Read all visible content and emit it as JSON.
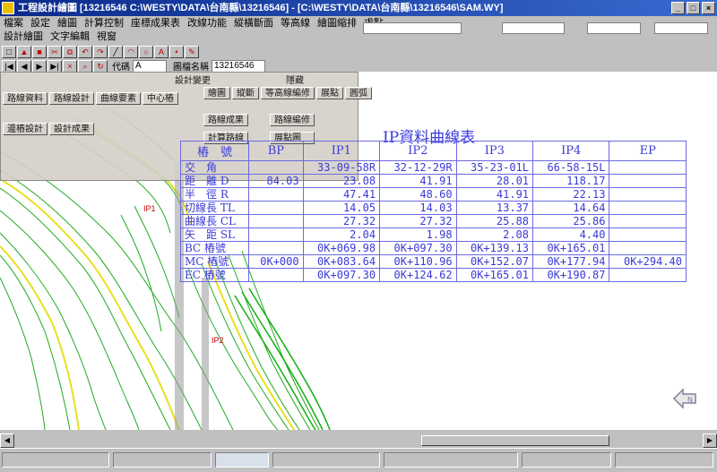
{
  "window": {
    "title": "工程設計繪圖 [13216546 C:\\WESTY\\DATA\\台南縣\\13216546] - [C:\\WESTY\\DATA\\台南縣\\13216546\\SAM.WY]",
    "controls": [
      "_",
      "□",
      "×"
    ]
  },
  "menu": {
    "row1": [
      "檔案",
      "設定",
      "繪圖",
      "計算控制",
      "座標成果表",
      "改線功能",
      "縱橫斷面",
      "等高線",
      "繪圖縮排",
      "求點"
    ],
    "row2": [
      "設計繪圖",
      "文字編輯",
      "視窗"
    ]
  },
  "toolbar": {
    "code_label": "代碼",
    "code_value": "A",
    "layer_label": "圖檔名稱",
    "layer_value": "13216546",
    "sublabel": "設計變更",
    "right_label": "隱藏"
  },
  "panel": {
    "tabs": [
      "繪圖",
      "縱斷",
      "等高線編修",
      "展點",
      "圓弧"
    ],
    "side_items": [
      "路線資料",
      "路線設計",
      "曲線要素",
      "中心樁",
      "邊樁設計",
      "設計成果"
    ],
    "buttons": [
      "路線成果",
      "計算路線",
      "路線編修",
      "展點圖"
    ]
  },
  "curve_table": {
    "title": "IP資料曲線表",
    "columns": [
      "樁　號",
      "BP",
      "IP1",
      "IP2",
      "IP3",
      "IP4",
      "EP"
    ],
    "rows": [
      {
        "label": "交　角",
        "values": [
          "",
          "",
          "33-09-58R",
          "32-12-29R",
          "35-23-01L",
          "66-58-15L",
          ""
        ]
      },
      {
        "label": "距　離 D",
        "values": [
          "",
          "84.03",
          "23.08",
          "41.91",
          "28.01",
          "118.17",
          ""
        ]
      },
      {
        "label": "半　徑 R",
        "values": [
          "",
          "",
          "47.41",
          "48.60",
          "41.91",
          "22.13",
          ""
        ]
      },
      {
        "label": "切線長 TL",
        "values": [
          "",
          "",
          "14.05",
          "14.03",
          "13.37",
          "14.64",
          ""
        ]
      },
      {
        "label": "曲線長 CL",
        "values": [
          "",
          "",
          "27.32",
          "27.32",
          "25.88",
          "25.86",
          ""
        ]
      },
      {
        "label": "矢　距 SL",
        "values": [
          "",
          "",
          "2.04",
          "1.98",
          "2.08",
          "4.40",
          ""
        ]
      },
      {
        "label": "BC 樁號",
        "values": [
          "",
          "",
          "0K+069.98",
          "0K+097.30",
          "0K+139.13",
          "0K+165.01",
          ""
        ]
      },
      {
        "label": "MC 樁號",
        "values": [
          "",
          "0K+000",
          "0K+083.64",
          "0K+110.96",
          "0K+152.07",
          "0K+177.94",
          "0K+294.40"
        ]
      },
      {
        "label": "EC 樁號",
        "values": [
          "",
          "",
          "0K+097.30",
          "0K+124.62",
          "0K+165.01",
          "0K+190.87",
          ""
        ]
      }
    ]
  },
  "map": {
    "markers": [
      "IP1",
      "IP2"
    ],
    "compass_label": "N"
  },
  "colors": {
    "table_text": "#3a3ad8",
    "contour_green": "#22aa22",
    "contour_yellow": "#e8e020",
    "title_bar": "#0a2a8a"
  },
  "status": {
    "panes": [
      "",
      "",
      "",
      "",
      "",
      "",
      ""
    ]
  }
}
